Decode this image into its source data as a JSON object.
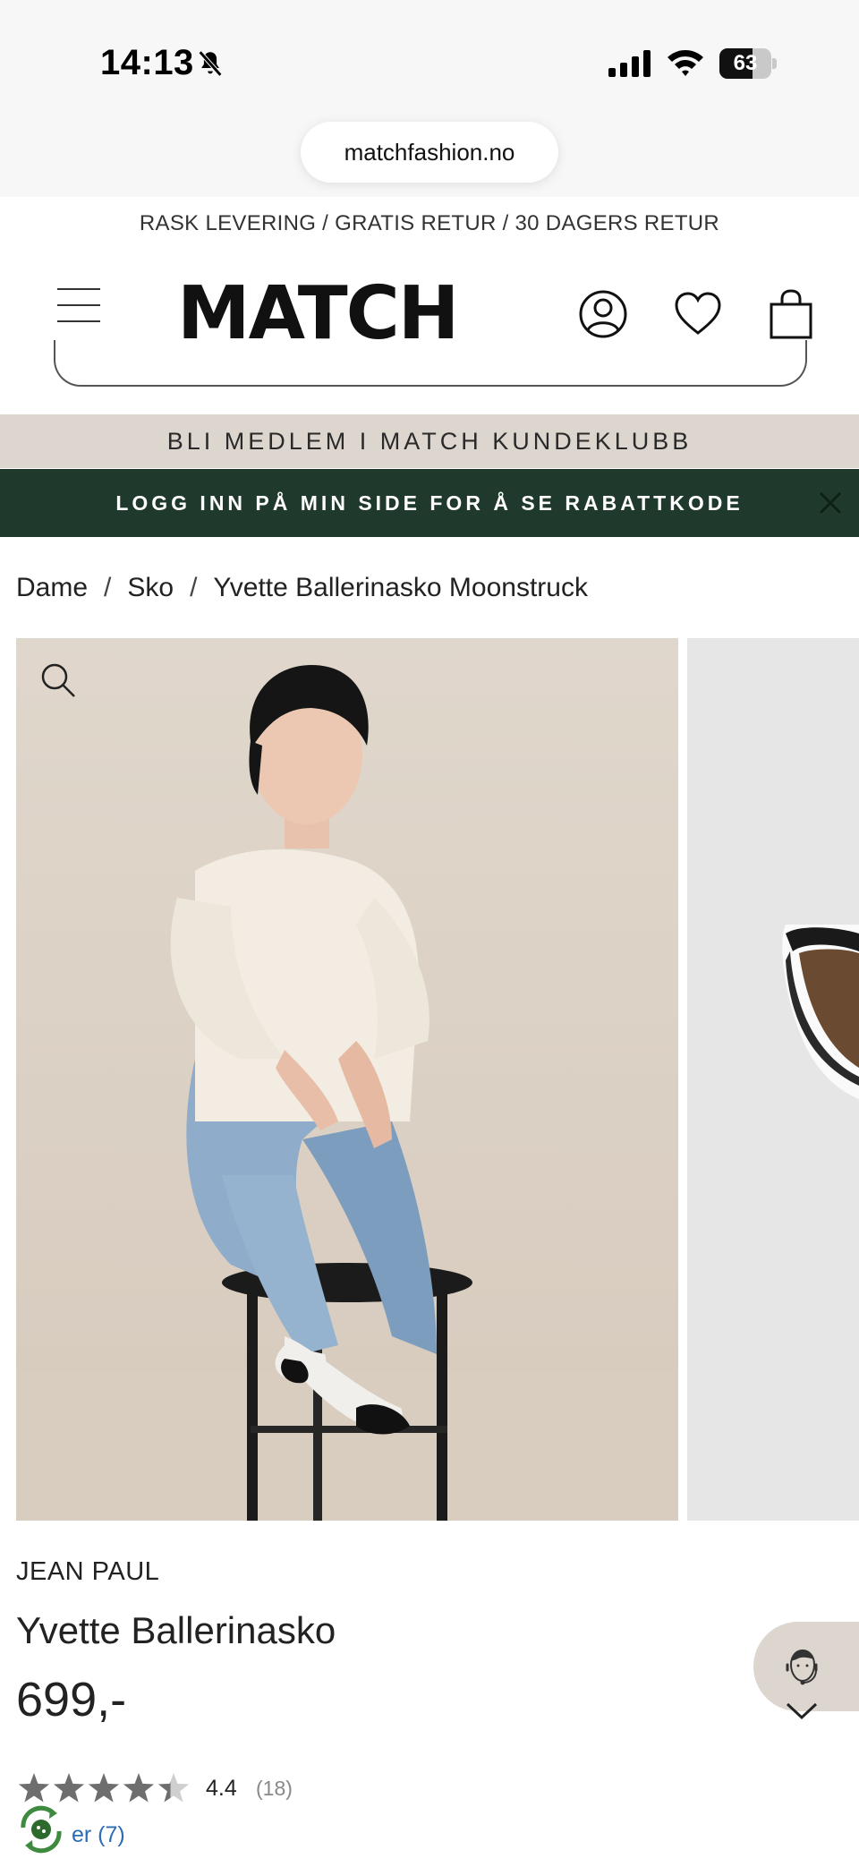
{
  "status_bar": {
    "time": "14:13",
    "battery_percent": "63",
    "battery_level": 0.63,
    "icons": [
      "bell-slash-icon",
      "signal-icon",
      "wifi-icon",
      "battery-icon"
    ]
  },
  "browser": {
    "url": "matchfashion.no"
  },
  "site": {
    "shipping_info": "RASK LEVERING / GRATIS RETUR / 30 DAGERS RETUR",
    "logo": "MATCH",
    "header_icons": [
      "menu-icon",
      "account-icon",
      "heart-icon",
      "bag-icon"
    ]
  },
  "banners": {
    "club": "BLI MEDLEM I MATCH KUNDEKLUBB",
    "login": "LOGG INN PÅ MIN SIDE FOR Å SE RABATTKODE",
    "club_color": "#ddd6cf",
    "login_color": "#1f3a2d"
  },
  "breadcrumb": {
    "items": [
      "Dame",
      "Sko",
      "Yvette Ballerinasko Moonstruck"
    ],
    "separator": "/"
  },
  "product": {
    "brand": "JEAN PAUL",
    "name": "Yvette Ballerinasko",
    "price": "699,-",
    "rating_value": "4.4",
    "rating_count": "(18)",
    "rating_stars": 4.4,
    "reviews_link": "er (7)"
  }
}
